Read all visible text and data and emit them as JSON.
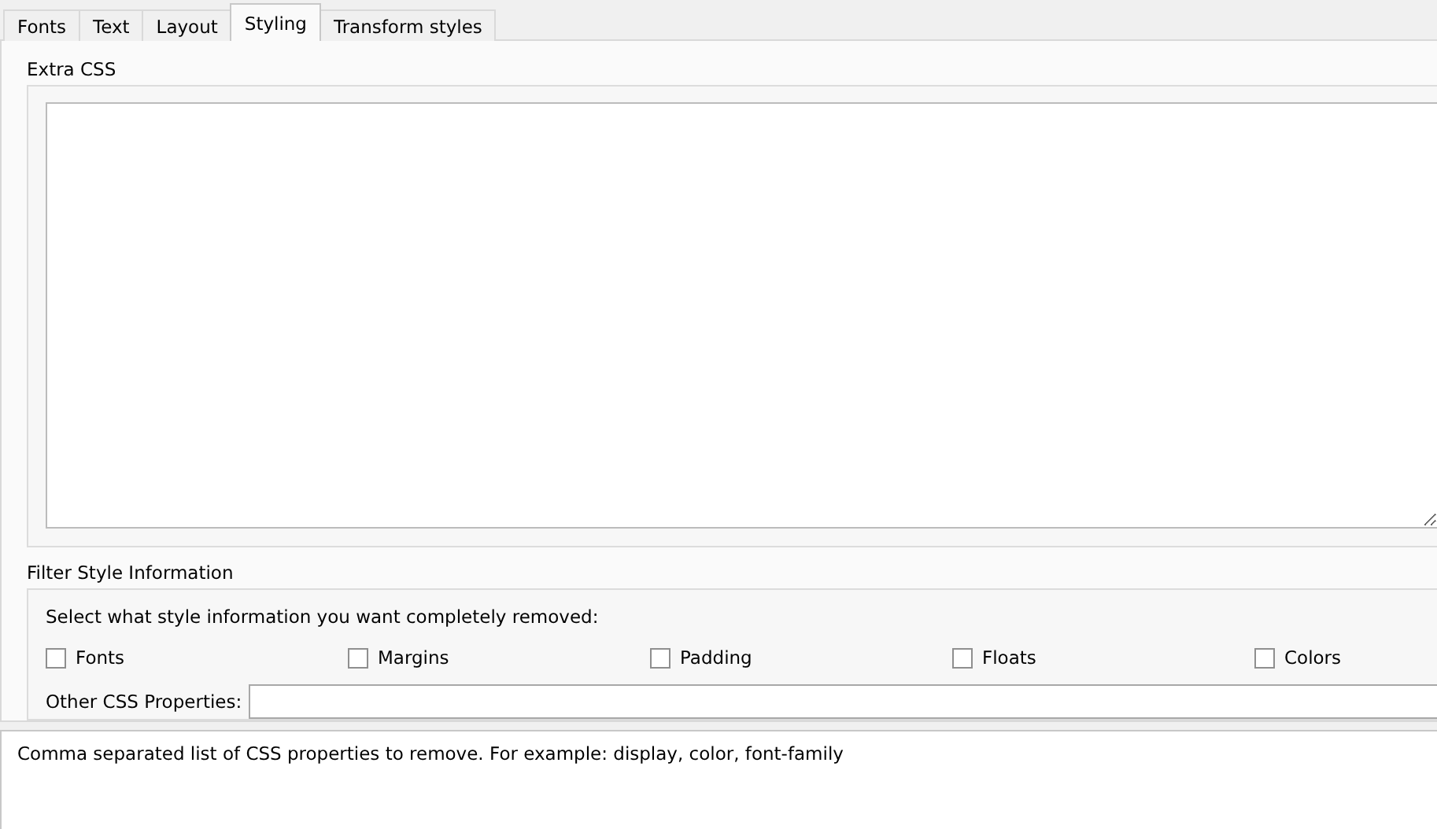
{
  "tabs": [
    {
      "label": "Fonts",
      "selected": false
    },
    {
      "label": "Text",
      "selected": false
    },
    {
      "label": "Layout",
      "selected": false
    },
    {
      "label": "Styling",
      "selected": true
    },
    {
      "label": "Transform styles",
      "selected": false
    }
  ],
  "extra_css": {
    "label": "Extra CSS"
  },
  "filter": {
    "label": "Filter Style Information",
    "prompt": "Select what style information you want completely removed:",
    "options": [
      {
        "label": "Fonts",
        "checked": false
      },
      {
        "label": "Margins",
        "checked": false
      },
      {
        "label": "Padding",
        "checked": false
      },
      {
        "label": "Floats",
        "checked": false
      },
      {
        "label": "Colors",
        "checked": false
      }
    ],
    "other_label": "Other CSS Properties:"
  },
  "help_text": "Comma separated list of CSS properties to remove. For example: display, color, font-family"
}
